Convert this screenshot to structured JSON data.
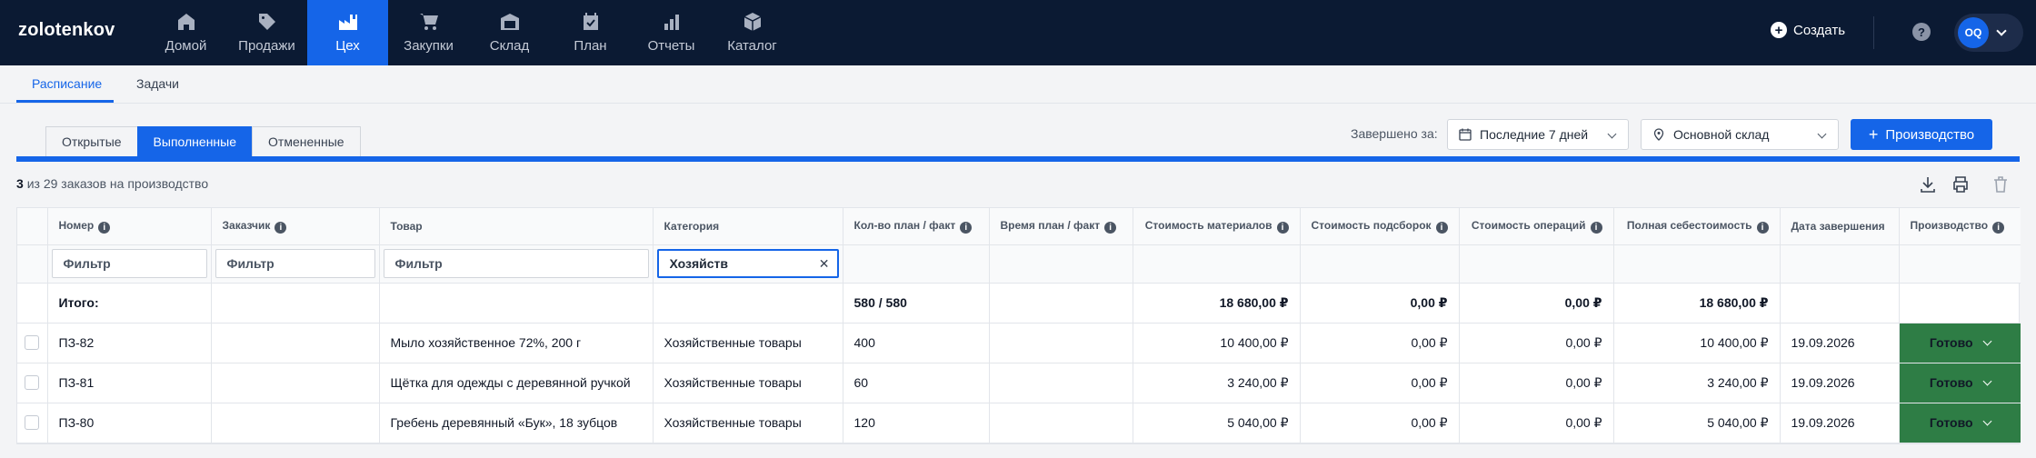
{
  "app": {
    "logo": "zolotenkov"
  },
  "nav": [
    {
      "label": "Домой",
      "icon": "home-icon"
    },
    {
      "label": "Продажи",
      "icon": "tag-icon"
    },
    {
      "label": "Цех",
      "icon": "factory-icon",
      "active": true
    },
    {
      "label": "Закупки",
      "icon": "cart-icon"
    },
    {
      "label": "Склад",
      "icon": "warehouse-icon"
    },
    {
      "label": "План",
      "icon": "calendar-check-icon"
    },
    {
      "label": "Отчеты",
      "icon": "bar-chart-icon"
    },
    {
      "label": "Каталог",
      "icon": "box-icon"
    }
  ],
  "header": {
    "create_label": "Создать",
    "help": "?",
    "user_initials": "OQ"
  },
  "subtabs": [
    {
      "label": "Расписание",
      "active": true
    },
    {
      "label": "Задачи"
    }
  ],
  "status_tabs": [
    {
      "label": "Открытые"
    },
    {
      "label": "Выполненные",
      "active": true
    },
    {
      "label": "Отмененные"
    }
  ],
  "filters": {
    "finished_label": "Завершено за:",
    "period": "Последние 7 дней",
    "warehouse": "Основной склад",
    "production_button": "Производство"
  },
  "summary": {
    "shown": "3",
    "text": "из 29 заказов на производство"
  },
  "table": {
    "columns": [
      "Номер",
      "Заказчик",
      "Товар",
      "Категория",
      "Кол-во план / факт",
      "Время план / факт",
      "Стоимость материалов",
      "Стоимость подсборок",
      "Стоимость операций",
      "Полная себестоимость",
      "Дата завершения",
      "Производство"
    ],
    "filter_placeholder": "Фильтр",
    "category_filter_value": "Хозяйств",
    "total": {
      "label": "Итого:",
      "qty": "580 / 580",
      "materials": "18 680,00 ₽",
      "subassemblies": "0,00 ₽",
      "operations": "0,00 ₽",
      "full_cost": "18 680,00 ₽"
    },
    "rows": [
      {
        "number": "ПЗ-82",
        "customer": "",
        "product": "Мыло хозяйственное 72%, 200 г",
        "category": "Хозяйственные товары",
        "qty": "400",
        "time": "",
        "materials": "10 400,00 ₽",
        "subassemblies": "0,00 ₽",
        "operations": "0,00 ₽",
        "full_cost": "10 400,00 ₽",
        "date": "19.09.2026",
        "status": "Готово"
      },
      {
        "number": "ПЗ-81",
        "customer": "",
        "product": "Щётка для одежды с деревянной ручкой",
        "category": "Хозяйственные товары",
        "qty": "60",
        "time": "",
        "materials": "3 240,00 ₽",
        "subassemblies": "0,00 ₽",
        "operations": "0,00 ₽",
        "full_cost": "3 240,00 ₽",
        "date": "19.09.2026",
        "status": "Готово"
      },
      {
        "number": "ПЗ-80",
        "customer": "",
        "product": "Гребень деревянный «Бук», 18 зубцов",
        "category": "Хозяйственные товары",
        "qty": "120",
        "time": "",
        "materials": "5 040,00 ₽",
        "subassemblies": "0,00 ₽",
        "operations": "0,00 ₽",
        "full_cost": "5 040,00 ₽",
        "date": "19.09.2026",
        "status": "Готово"
      }
    ]
  },
  "colors": {
    "nav_bg": "#0b1a33",
    "accent": "#1565e8",
    "status_done": "#2e7d45"
  }
}
